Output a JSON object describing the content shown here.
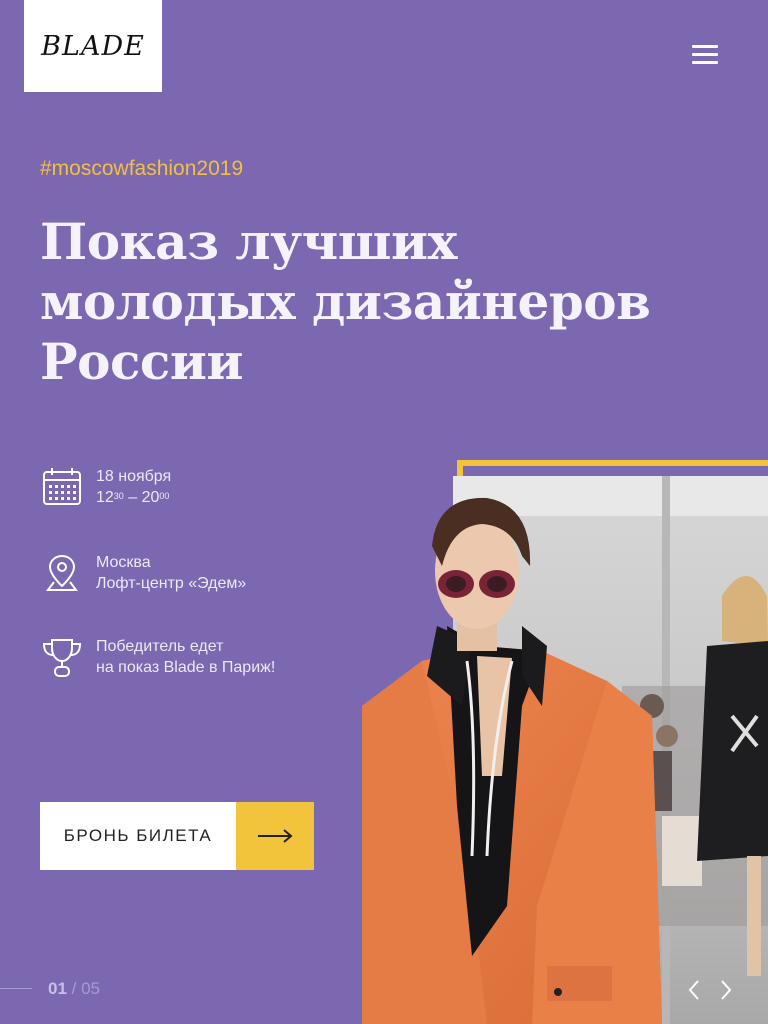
{
  "brand": {
    "logo": "BLADE"
  },
  "hero": {
    "hashtag": "#moscowfashion2019",
    "title": "Показ лучших молодых дизайнеров России"
  },
  "info": {
    "date": {
      "icon": "calendar-icon",
      "line1": "18 ноября",
      "time_start": "12",
      "time_start_min": "30",
      "time_sep": " – ",
      "time_end": "20",
      "time_end_min": "00"
    },
    "place": {
      "icon": "map-pin-icon",
      "line1": "Москва",
      "line2": "Лофт-центр «Эдем»"
    },
    "prize": {
      "icon": "trophy-icon",
      "line1": "Победитель едет",
      "line2": "на показ Blade в Париж!"
    }
  },
  "cta": {
    "label": "БРОНЬ БИЛЕТА",
    "icon": "arrow-right-icon"
  },
  "pager": {
    "current": "01",
    "separator": " / ",
    "total": "05"
  },
  "colors": {
    "background": "#7b68b0",
    "accent": "#f2c43c",
    "hashtag": "#f0c040"
  }
}
